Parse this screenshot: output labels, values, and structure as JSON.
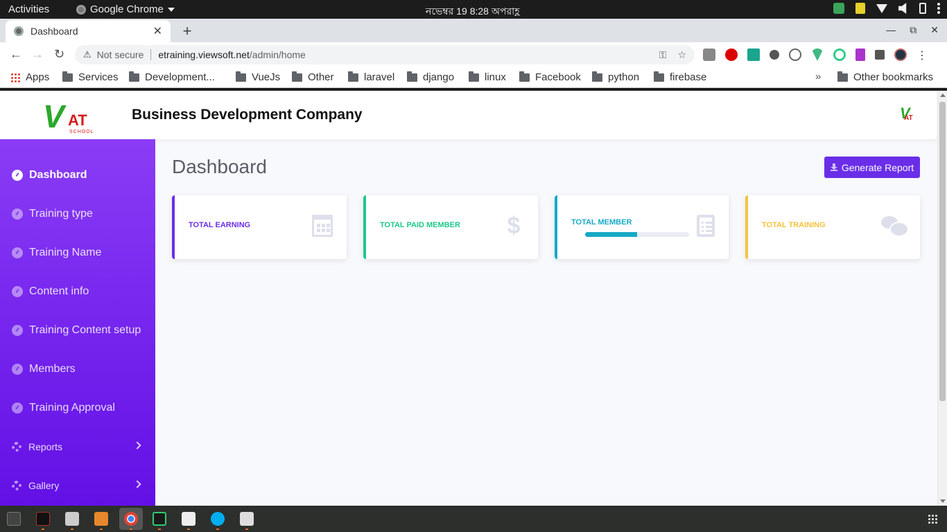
{
  "system": {
    "activities": "Activities",
    "app_name": "Google Chrome",
    "clock": "নভেম্বর 19   8:28 অপরাহ্ণ"
  },
  "browser": {
    "tab_title": "Dashboard",
    "tab_close": "✕",
    "new_tab": "+",
    "security_label": "Not secure",
    "url_host": "etraining.viewsoft.net",
    "url_path": "/admin/home",
    "bookmarks": [
      {
        "label": "Apps",
        "icon": "apps-icon"
      },
      {
        "label": "Services",
        "icon": "folder-icon"
      },
      {
        "label": "Development...",
        "icon": "folder-icon"
      },
      {
        "label": "VueJs",
        "icon": "folder-icon"
      },
      {
        "label": "Other",
        "icon": "folder-icon"
      },
      {
        "label": "laravel",
        "icon": "folder-icon"
      },
      {
        "label": "django",
        "icon": "folder-icon"
      },
      {
        "label": "linux",
        "icon": "folder-icon"
      },
      {
        "label": "Facebook",
        "icon": "folder-icon"
      },
      {
        "label": "python",
        "icon": "folder-icon"
      },
      {
        "label": "firebase",
        "icon": "folder-icon"
      }
    ],
    "bookmarks_overflow": "»",
    "other_bookmarks": "Other bookmarks"
  },
  "header": {
    "logo": {
      "v": "V",
      "at": "AT",
      "school": "SCHOOL"
    },
    "company_name": "Business Development Company"
  },
  "sidebar": {
    "items": [
      {
        "label": "Dashboard",
        "active": true
      },
      {
        "label": "Training type"
      },
      {
        "label": "Training Name"
      },
      {
        "label": "Content info"
      },
      {
        "label": "Training Content setup"
      },
      {
        "label": "Members"
      },
      {
        "label": "Training Approval"
      },
      {
        "label": "Reports",
        "has_submenu": true
      },
      {
        "label": "Gallery",
        "has_submenu": true
      }
    ]
  },
  "main": {
    "page_title": "Dashboard",
    "generate_report": "Generate Report",
    "cards": [
      {
        "label": "TOTAL EARNING",
        "icon": "calendar-icon",
        "color": "#6a2ee8"
      },
      {
        "label": "TOTAL PAID MEMBER",
        "icon": "dollar-icon",
        "color": "#1cc88a"
      },
      {
        "label": "TOTAL MEMBER",
        "icon": "clipboard-icon",
        "color": "#17a9c6",
        "progress": 0.5
      },
      {
        "label": "TOTAL TRAINING",
        "icon": "comments-icon",
        "color": "#f6c23e"
      }
    ]
  },
  "colors": {
    "sidebar_top": "#8a3cf5",
    "sidebar_bottom": "#6310e6",
    "primary": "#6a2ee8"
  }
}
